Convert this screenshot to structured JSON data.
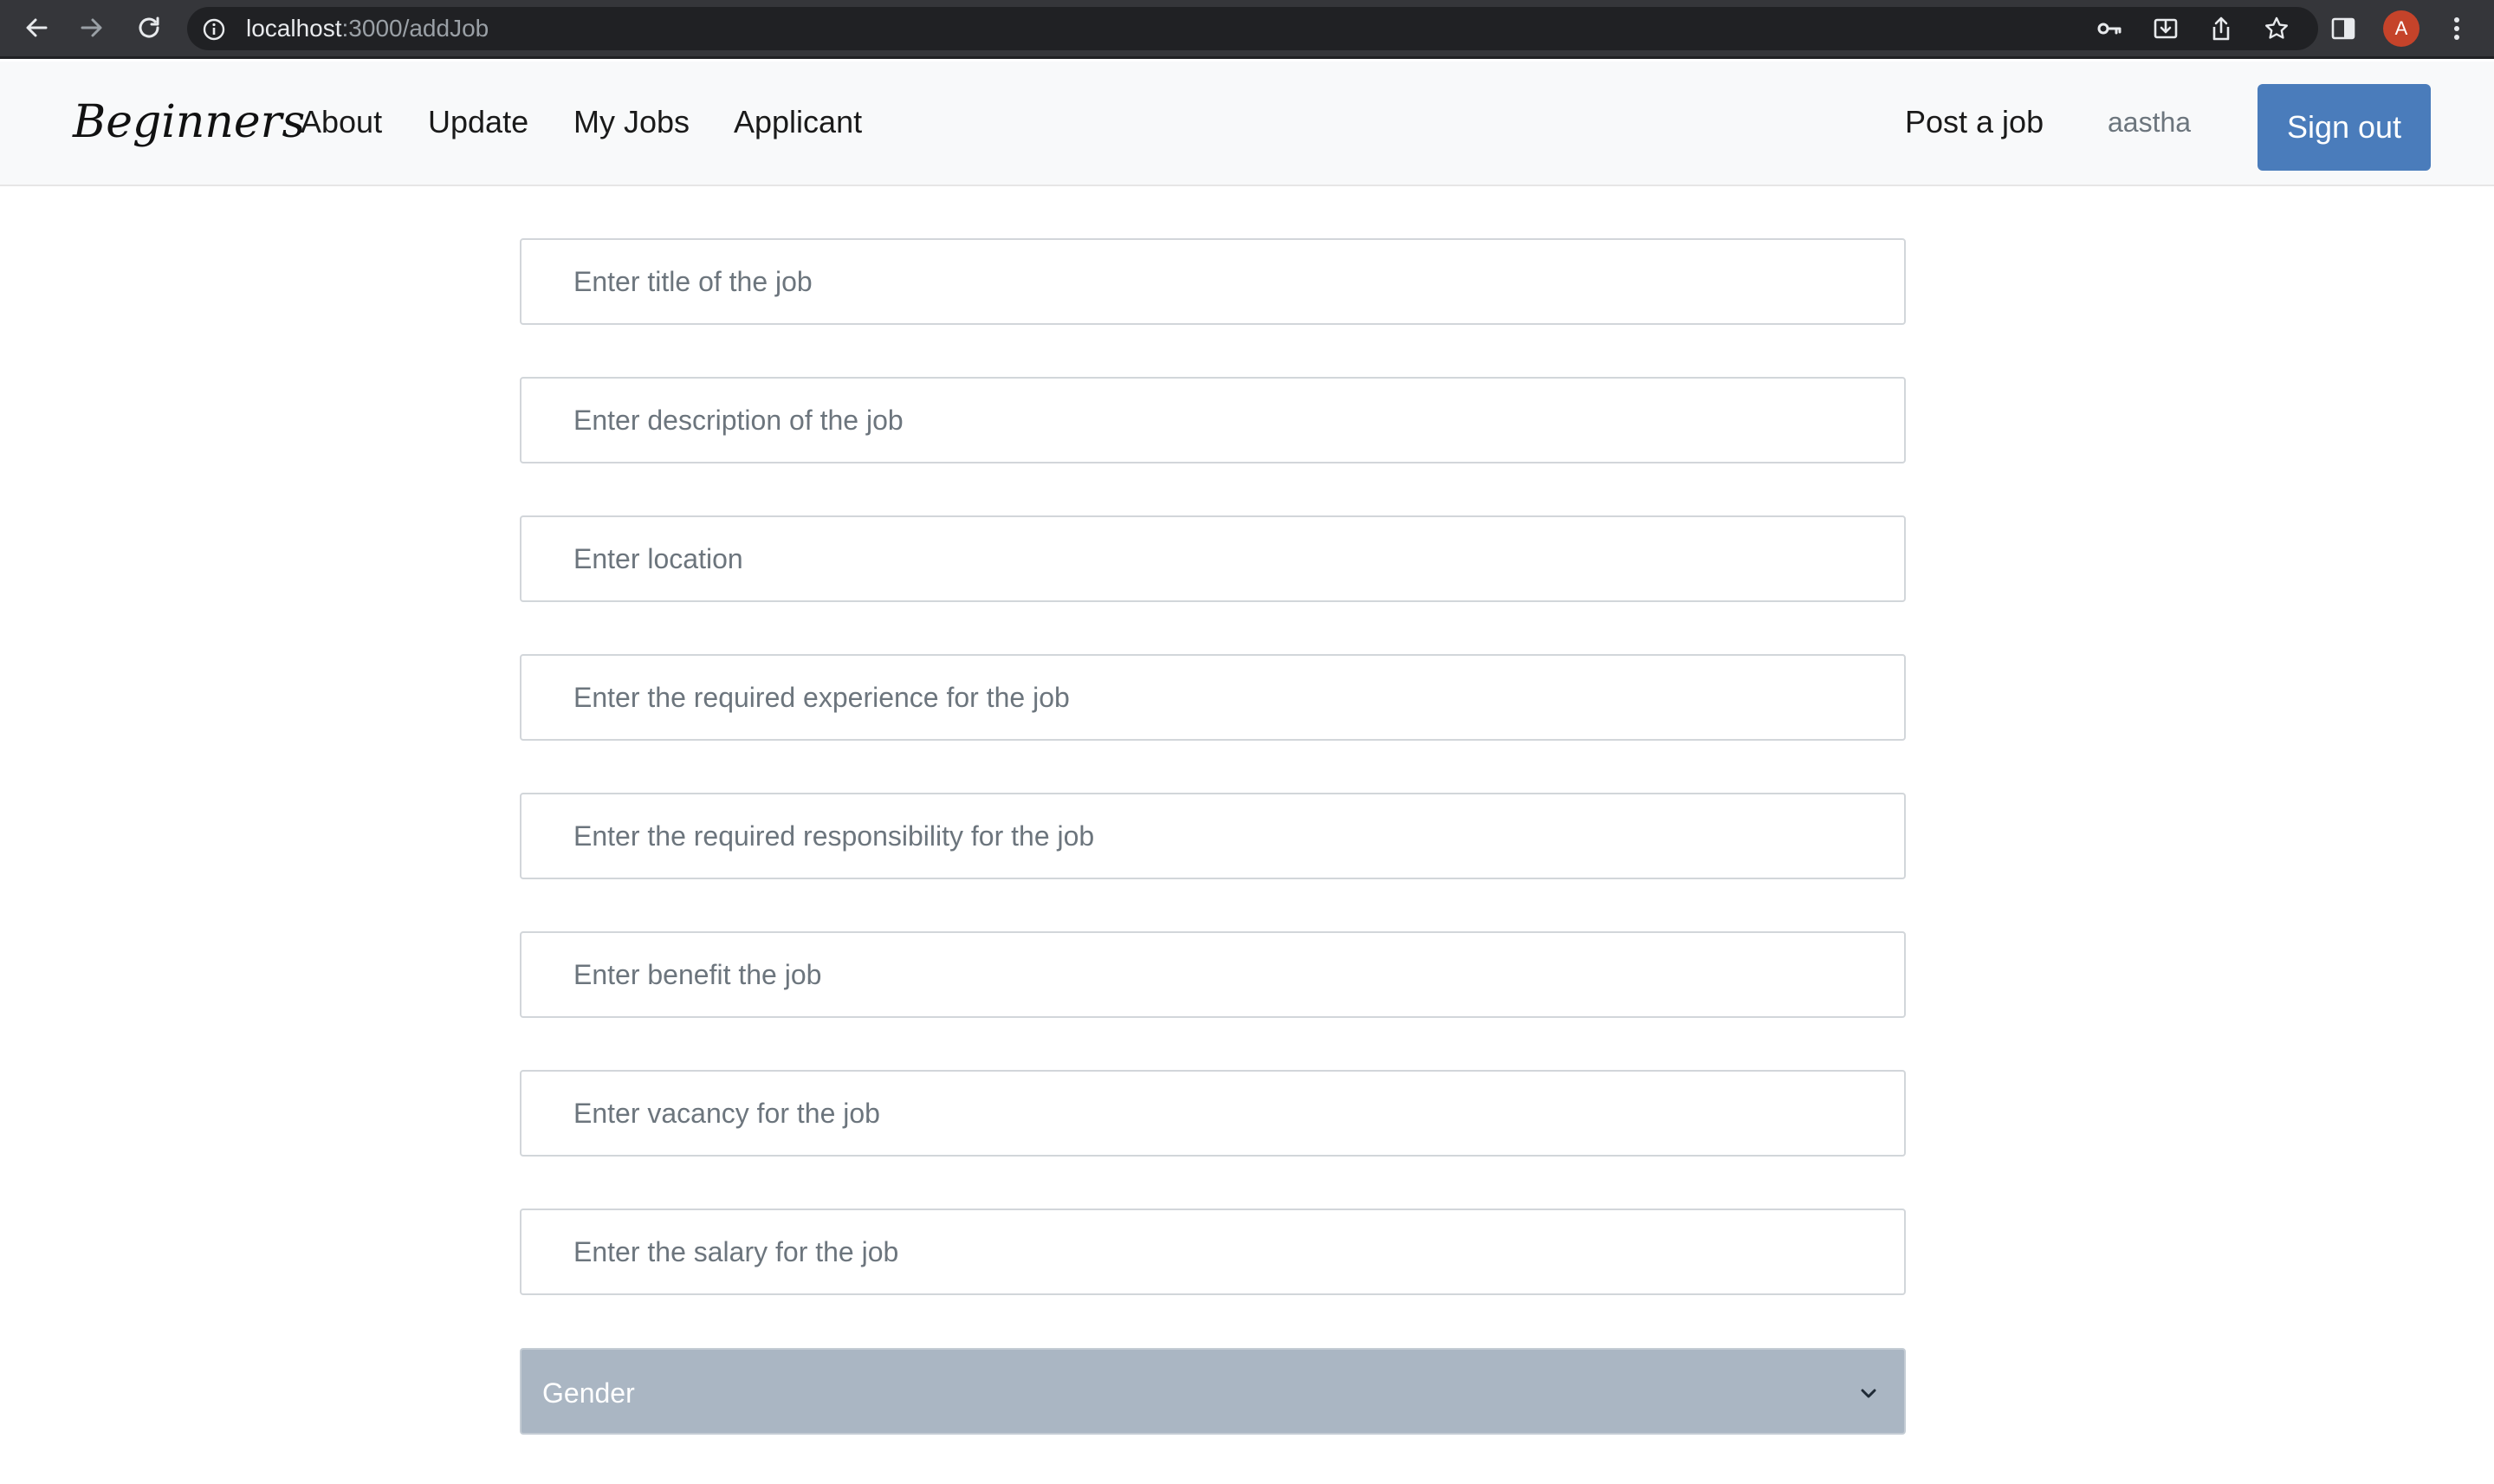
{
  "browser": {
    "url_host": "localhost",
    "url_path": ":3000/addJob",
    "profile_initial": "A"
  },
  "navbar": {
    "brand": "Beginners",
    "links": {
      "about": "About",
      "update": "Update",
      "my_jobs": "My Jobs",
      "applicant": "Applicant",
      "post_job": "Post a job"
    },
    "username": "aastha",
    "signout_label": "Sign out"
  },
  "form": {
    "title_placeholder": "Enter title of the job",
    "description_placeholder": "Enter description of the job",
    "location_placeholder": "Enter location",
    "experience_placeholder": "Enter the required experience for the job",
    "responsibility_placeholder": "Enter the required responsibility for the job",
    "benefit_placeholder": "Enter benefit the job",
    "vacancy_placeholder": "Enter vacancy for the job",
    "salary_placeholder": "Enter the salary for the job",
    "gender_label": "Gender"
  },
  "colors": {
    "primary_button": "#4a7cbb",
    "select_background": "#aab6c3",
    "chrome_background": "#35363a"
  }
}
